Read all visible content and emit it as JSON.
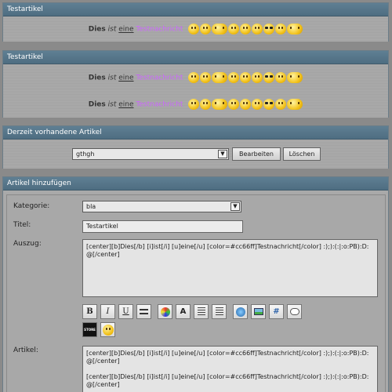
{
  "panel1": {
    "title": "Testartikel",
    "line": {
      "bold": "Dies",
      "italic": "ist",
      "underline": "eine",
      "colored": "Testnachricht"
    }
  },
  "panel2": {
    "title": "Testartikel",
    "line1": {
      "bold": "Dies",
      "italic": "ist",
      "underline": "eine",
      "colored": "Testnachricht"
    },
    "line2": {
      "bold": "Dies",
      "italic": "ist",
      "underline": "eine",
      "colored": "Testnachricht"
    }
  },
  "panel3": {
    "title": "Derzeit vorhandene Artikel",
    "select_value": "gthgh",
    "edit_button": "Bearbeiten",
    "delete_button": "Löschen"
  },
  "panel4": {
    "title": "Artikel hinzufügen",
    "category_label": "Kategorie:",
    "category_value": "bla",
    "title_label": "Titel:",
    "title_value": "Testartikel",
    "excerpt_label": "Auszug:",
    "excerpt_value": "[center][b]Dies[/b] [i]ist[/i] [u]eine[/u] [color=#cc66ff]Testnachricht[/color] :);):(:|:o:PB):D:@[/center]",
    "article_label": "Artikel:",
    "article_value": "[center][b]Dies[/b] [i]ist[/i] [u]eine[/u] [color=#cc66ff]Testnachricht[/color] :);):(:|:o:PB):D:@[/center]\n\n[center][b]Dies[/b] [i]ist[/i] [u]eine[/u] [color=#cc66ff]Testnachricht[/color] :);):(:|:o:PB):D:@[/center]",
    "toolbar": {
      "bold": "B",
      "italic": "I",
      "underline": "U",
      "brand": "STORE"
    }
  },
  "colors": {
    "header": "#557789",
    "accent_pink": "#cc66ff"
  }
}
